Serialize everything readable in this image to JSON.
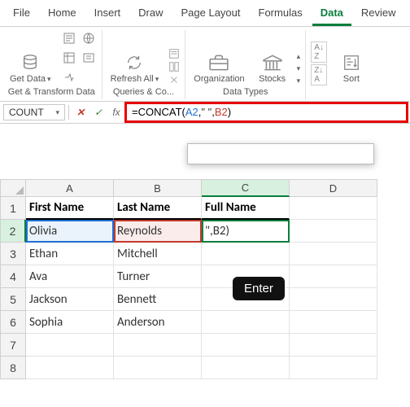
{
  "tabs": [
    "File",
    "Home",
    "Insert",
    "Draw",
    "Page Layout",
    "Formulas",
    "Data",
    "Review"
  ],
  "active_tab": "Data",
  "ribbon": {
    "get_data": {
      "label": "Get Data",
      "group_label": "Get & Transform Data"
    },
    "refresh": {
      "label": "Refresh All",
      "group_label": "Queries & Co..."
    },
    "datatypes": {
      "org": "Organization",
      "stocks": "Stocks",
      "group_label": "Data Types"
    },
    "sort": {
      "label": "Sort"
    }
  },
  "namebox": "COUNT",
  "formula": {
    "fn": "=CONCAT(",
    "ref1": "A2",
    "sep1": ",",
    "str": "\" \"",
    "sep2": ",",
    "ref2": "B2",
    "close": ")"
  },
  "tooltip_filler": " ",
  "columns": [
    "A",
    "B",
    "C",
    "D"
  ],
  "row_numbers": [
    "1",
    "2",
    "3",
    "4",
    "5",
    "6",
    "7",
    "8"
  ],
  "headers": {
    "a": "First Name",
    "b": "Last Name",
    "c": "Full Name"
  },
  "rows": [
    {
      "a": "Olivia",
      "b": "Reynolds",
      "c": "\",B2)"
    },
    {
      "a": "Ethan",
      "b": "Mitchell",
      "c": ""
    },
    {
      "a": "Ava",
      "b": "Turner",
      "c": ""
    },
    {
      "a": "Jackson",
      "b": "Bennett",
      "c": ""
    },
    {
      "a": "Sophia",
      "b": "Anderson",
      "c": ""
    }
  ],
  "enter_label": "Enter",
  "colors": {
    "accent": "#0a7d3e",
    "red": "#e60000",
    "ref_blue": "#1f6fd0",
    "ref_red": "#c0392b"
  }
}
